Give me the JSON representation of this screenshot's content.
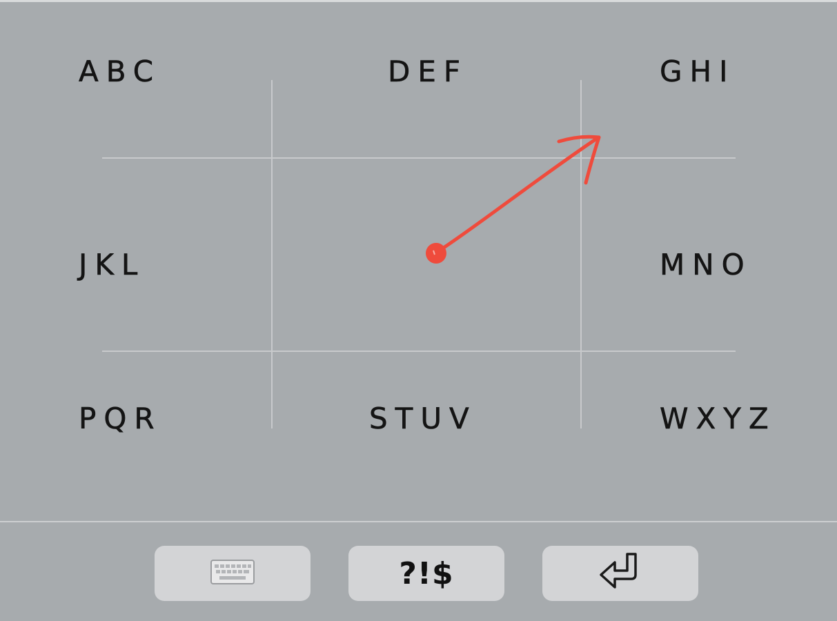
{
  "keypad": {
    "groups": {
      "abc": "ABC",
      "def": "DEF",
      "ghi": "GHI",
      "jkl": "JKL",
      "mno": "MNO",
      "pqrs": "PQR",
      "tuv": "STUV",
      "wxyz": "WXYZ"
    }
  },
  "gesture": {
    "color": "#ef4b3c",
    "description_direction": "up-right"
  },
  "bottom_bar": {
    "keyboard_icon": "keyboard-icon",
    "symbols_label": "?!$",
    "return_icon": "return-arrow-icon"
  },
  "colors": {
    "background": "#a7abae",
    "grid_lines": "#c8cacc",
    "key_background": "#d3d4d6",
    "text": "#141414"
  }
}
